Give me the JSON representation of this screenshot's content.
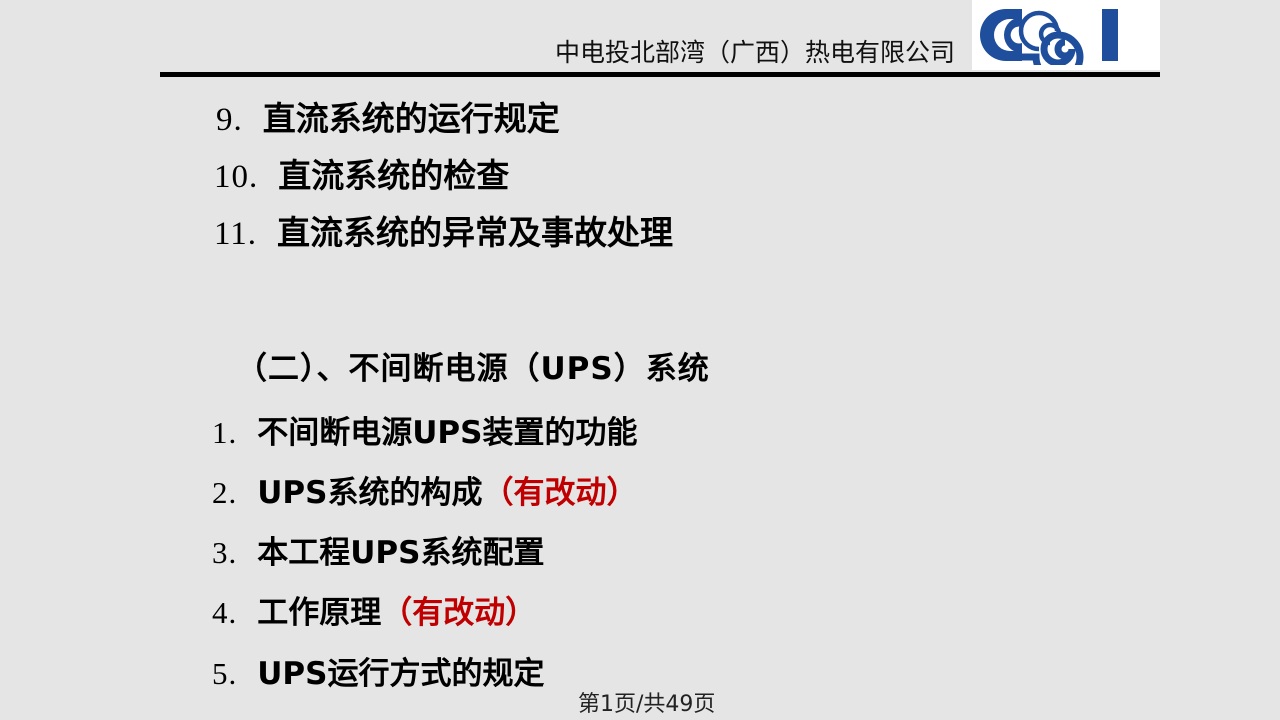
{
  "slide": {
    "background_color": "#E5E5E5",
    "text_color": "#000000",
    "accent_red": "#C00000",
    "logo_blue": "#1F4E9C"
  },
  "header": {
    "company_name": "中电投北部湾（广西）热电有限公司",
    "logo_alt": "cpi-logo",
    "logo_box_color": "#FFFFFF",
    "rule_color": "#000000"
  },
  "content": {
    "continued_items": [
      {
        "number": "9.",
        "text": "直流系统的运行规定"
      },
      {
        "number": "10.",
        "text": "直流系统的检查"
      },
      {
        "number": "11.",
        "text": "直流系统的异常及事故处理"
      }
    ],
    "section_heading": "（二）、不间断电源（UPS）系统",
    "section_items": [
      {
        "number": "1.",
        "text": "不间断电源UPS装置的功能",
        "note": ""
      },
      {
        "number": "2.",
        "text": "UPS系统的构成",
        "note": "（有改动）"
      },
      {
        "number": "3.",
        "text": "本工程UPS系统配置",
        "note": ""
      },
      {
        "number": "4.",
        "text": "工作原理",
        "note": "（有改动）"
      },
      {
        "number": "5.",
        "text": "UPS运行方式的规定",
        "note": ""
      }
    ]
  },
  "footer": {
    "page_indicator": "第1页/共49页"
  }
}
